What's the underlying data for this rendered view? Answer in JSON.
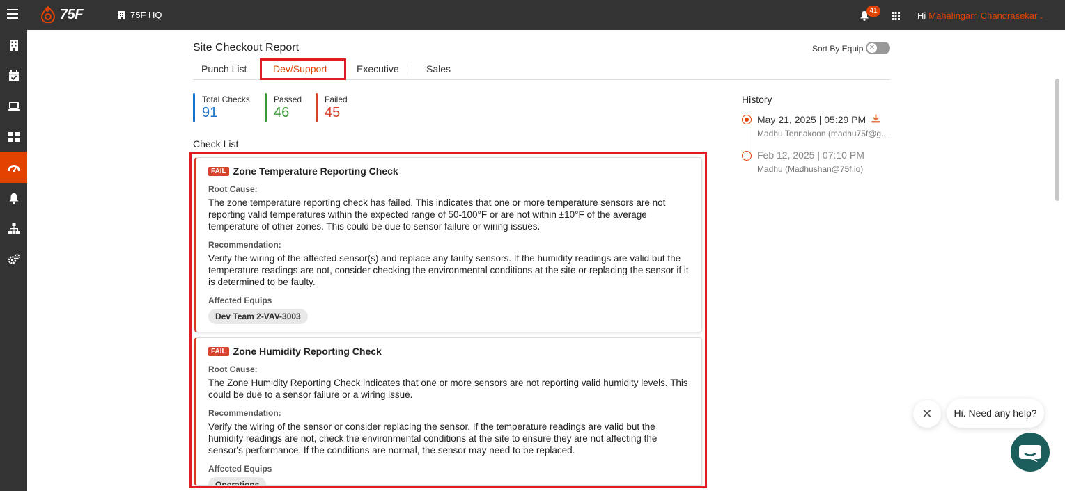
{
  "topbar": {
    "logo_text": "75F",
    "site_name": "75F HQ",
    "notification_count": "41",
    "greeting": "Hi",
    "user_name": "Mahalingam Chandrasekar"
  },
  "page": {
    "title": "Site Checkout Report",
    "sort_label": "Sort By Equip",
    "sort_enabled": false
  },
  "tabs": [
    {
      "label": "Punch List",
      "active": false
    },
    {
      "label": "Dev/Support",
      "active": true
    },
    {
      "label": "Executive",
      "active": false
    },
    {
      "label": "Sales",
      "active": false
    }
  ],
  "stats": {
    "total": {
      "label": "Total Checks",
      "value": "91",
      "color": "#1a73c9"
    },
    "passed": {
      "label": "Passed",
      "value": "46",
      "color": "#3a9a3a"
    },
    "failed": {
      "label": "Failed",
      "value": "45",
      "color": "#d7442c"
    }
  },
  "checklist": {
    "title": "Check List",
    "cards": [
      {
        "status": "FAIL",
        "title": "Zone Temperature Reporting Check",
        "root_cause_label": "Root Cause:",
        "root_cause": "The zone temperature reporting check has failed. This indicates that one or more temperature sensors are not reporting valid temperatures within the expected range of 50-100°F or are not within ±10°F of the average temperature of other zones. This could be due to sensor failure or wiring issues.",
        "recommendation_label": "Recommendation:",
        "recommendation": "Verify the wiring of the affected sensor(s) and replace any faulty sensors. If the humidity readings are valid but the temperature readings are not, consider checking the environmental conditions at the site or replacing the sensor if it is determined to be faulty.",
        "affected_label": "Affected Equips",
        "affected": "Dev Team 2-VAV-3003"
      },
      {
        "status": "FAIL",
        "title": "Zone Humidity Reporting Check",
        "root_cause_label": "Root Cause:",
        "root_cause": "The Zone Humidity Reporting Check indicates that one or more sensors are not reporting valid humidity levels. This could be due to a sensor failure or a wiring issue.",
        "recommendation_label": "Recommendation:",
        "recommendation": "Verify the wiring of the sensor or consider replacing the sensor. If the temperature readings are valid but the humidity readings are not, check the environmental conditions at the site to ensure they are not affecting the sensor's performance. If the conditions are normal, the sensor may need to be replaced.",
        "affected_label": "Affected Equips",
        "affected": "Operations"
      }
    ]
  },
  "history": {
    "title": "History",
    "entries": [
      {
        "date": "May 21, 2025 | 05:29 PM",
        "user": "Madhu Tennakoon (madhu75f@g...",
        "active": true
      },
      {
        "date": "Feb 12, 2025 | 07:10 PM",
        "user": "Madhu (Madhushan@75f.io)",
        "active": false
      }
    ]
  },
  "chat": {
    "bubble_text": "Hi. Need any help?",
    "close_glyph": "✕"
  },
  "colors": {
    "accent": "#e24301",
    "topbar": "#333333",
    "highlight": "#e01c24"
  }
}
